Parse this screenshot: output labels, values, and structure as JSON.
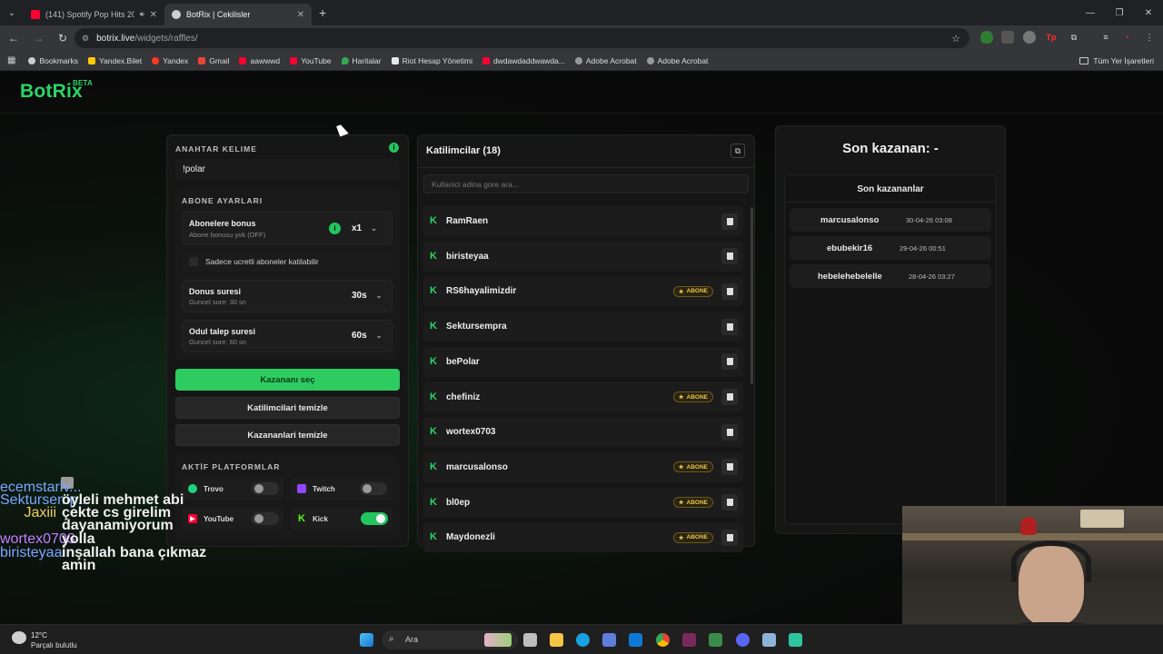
{
  "browser": {
    "tabs": [
      {
        "title": "(141) Spotify Pop Hits 2026",
        "favicon_color": "#ff0033"
      },
      {
        "title": "BotRix | Cekilisler",
        "favicon_color": "#cfcfcf"
      }
    ],
    "url_host": "botrix.live",
    "url_path": "/widgets/raffles/",
    "bookmarks": [
      {
        "label": "Bookmarks",
        "color": "#cccccc"
      },
      {
        "label": "Yandex.Bilet",
        "color": "#ffcc00"
      },
      {
        "label": "Yandex",
        "color": "#ff3b1f"
      },
      {
        "label": "Gmail",
        "color": "#ea4335"
      },
      {
        "label": "aawwwd",
        "color": "#ff0033"
      },
      {
        "label": "YouTube",
        "color": "#ff0033"
      },
      {
        "label": "Haritalar",
        "color": "#34a853"
      },
      {
        "label": "Riot Hesap Yönetimi",
        "color": "#e8e8e8"
      },
      {
        "label": "dwdawdaddwawda...",
        "color": "#ff0033"
      },
      {
        "label": "Adobe Acrobat",
        "color": "#cccccc"
      },
      {
        "label": "Adobe Acrobat",
        "color": "#cccccc"
      }
    ],
    "bookmarks_right": "Tüm Yer İşaretleri"
  },
  "site": {
    "logo": "BotRix",
    "logo_badge": "BETA"
  },
  "settings": {
    "keyword_label": "ANAHTAR KELIME",
    "keyword_value": "!polar",
    "sub_settings_label": "ABONE AYARLARI",
    "sub_bonus_title": "Abonelere bonus",
    "sub_bonus_sub": "Abone bonusu yok (OFF)",
    "sub_bonus_value": "x1",
    "paid_only_label": "Sadece ucretli aboneler katilabilir",
    "spin_title": "Donus suresi",
    "spin_sub": "Guncel sure: 30 sn",
    "spin_value": "30s",
    "claim_title": "Odul talep suresi",
    "claim_sub": "Guncel sure: 60 sn",
    "claim_value": "60s",
    "pick_winner": "Kazananı seç",
    "clear_participants": "Katilimcilari temizle",
    "clear_winners": "Kazananlari temizle",
    "platforms_label": "AKTİF PLATFORMLAR",
    "platforms": [
      {
        "name": "Trovo",
        "color": "#1fd17b",
        "on": false
      },
      {
        "name": "Twitch",
        "color": "#9146ff",
        "on": false
      },
      {
        "name": "YouTube",
        "color": "#ff0033",
        "on": false
      },
      {
        "name": "Kick",
        "color": "#53fc18",
        "on": true
      }
    ]
  },
  "participants": {
    "title": "Katilimcilar (18)",
    "search_placeholder": "Kullanici adina gore ara...",
    "badge_label": "ABONE",
    "list": [
      {
        "name": "RamRaen",
        "sub": false
      },
      {
        "name": "biristeyaa",
        "sub": false
      },
      {
        "name": "RS6hayalimizdir",
        "sub": true
      },
      {
        "name": "Sektursempra",
        "sub": false
      },
      {
        "name": "bePolar",
        "sub": false
      },
      {
        "name": "chefiniz",
        "sub": true
      },
      {
        "name": "wortex0703",
        "sub": false
      },
      {
        "name": "marcusalonso",
        "sub": true
      },
      {
        "name": "bl0ep",
        "sub": true
      },
      {
        "name": "Maydonezli",
        "sub": true
      }
    ]
  },
  "winners": {
    "last_winner_title": "Son kazanan: -",
    "recent_title": "Son kazananlar",
    "list": [
      {
        "name": "marcusalonso",
        "date": "30-04-26 03:08"
      },
      {
        "name": "ebubekir16",
        "date": "29-04-26 00:51"
      },
      {
        "name": "hebelehebelelle",
        "date": "28-04-26 03:27"
      }
    ]
  },
  "chat": [
    {
      "user": "ecemstarlv...",
      "msg": ""
    },
    {
      "user": "Sektursemp...",
      "msg": "öyleli mehmet abi"
    },
    {
      "user": "Jaxiii",
      "msg": "çekte cs girelim"
    },
    {
      "user": "",
      "msg": "dayanamıyorum"
    },
    {
      "user": "wortex0703",
      "msg": "yolla"
    },
    {
      "user": "biristeyaa",
      "msg": "inşallah bana çıkmaz"
    },
    {
      "user": "",
      "msg": "amin"
    }
  ],
  "taskbar": {
    "weather_temp": "12°C",
    "weather_desc": "Parçalı bulutlu",
    "search_label": "Ara"
  }
}
